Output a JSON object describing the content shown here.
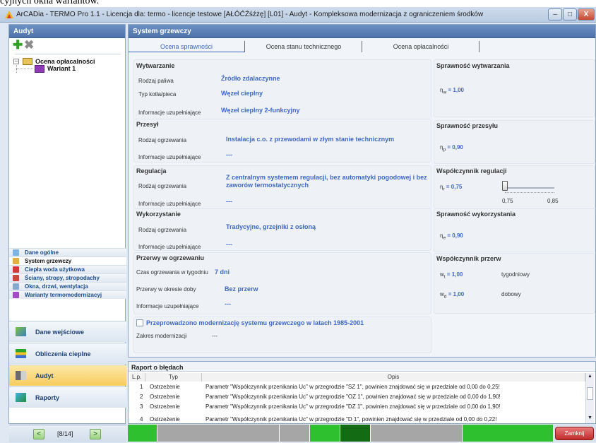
{
  "top_fragment": "cyjnych okna wariantów.",
  "window": {
    "title": "ArCADia - TERMO Pro 1.1 - Licencja dla: termo - licencje testowe [AŁÓĆŹśźżę] [L01] - Audyt - Kompleksowa modernizacja z ograniczeniem środków",
    "min": "–",
    "max": "□",
    "close": "X"
  },
  "left": {
    "header": "Audyt",
    "tree": {
      "root": "Ocena opłacalności",
      "child": "Wariant 1"
    },
    "sections": [
      "Dane ogólne",
      "System grzewczy",
      "Ciepła woda użytkowa",
      "Ściany, stropy, stropodachy",
      "Okna, drzwi, wentylacja",
      "Warianty termomodernizacyj"
    ],
    "nav": [
      "Dane wejściowe",
      "Obliczenia cieplne",
      "Audyt",
      "Raporty"
    ],
    "pager": {
      "prev": "<",
      "label": "[8/14]",
      "next": ">"
    }
  },
  "main": {
    "header": "System grzewczy",
    "tabs": [
      "Ocena sprawności",
      "Ocena stanu technicznego",
      "Ocena opłacalności"
    ],
    "wytwarzanie": {
      "title": "Wytwarzanie",
      "l1": "Rodzaj paliwa",
      "v1": "Źródło zdalaczynne",
      "l2": "Typ kotła/pieca",
      "v2": "Węzeł cieplny",
      "l3": "Informacje uzupełniające",
      "v3": "Węzeł cieplny 2-funkcyjny"
    },
    "przesyl": {
      "title": "Przesył",
      "l1": "Rodzaj ogrzewania",
      "v1": "Instalacja c.o. z przewodami w złym stanie technicznym",
      "l2": "Informacje uzupełniające",
      "v2": "---"
    },
    "regulacja": {
      "title": "Regulacja",
      "l1": "Rodzaj ogrzewania",
      "v1": "Z centralnym systemem regulacji, bez automatyki pogodowej i bez zaworów termostatycznych",
      "l2": "Informacje uzupełniające",
      "v2": "---"
    },
    "wykorzystanie": {
      "title": "Wykorzystanie",
      "l1": "Rodzaj ogrzewania",
      "v1": "Tradycyjne, grzejniki z osłoną",
      "l2": "Informacje uzupełniające",
      "v2": "---"
    },
    "przerwy": {
      "title": "Przerwy w ogrzewaniu",
      "l1": "Czas ogrzewania w tygodniu",
      "v1": "7 dni",
      "l2": "Przerwy w okresie doby",
      "v2": "Bez przerw",
      "l3": "Informacje uzupełniające",
      "v3": "---"
    },
    "modernizacja": {
      "checkbox": "Przeprowadzono modernizację systemu grzewczego w latach 1985-2001",
      "label": "Zakres modernizacji",
      "value": "---"
    },
    "r_wytw": {
      "title": "Sprawność wytwarzania",
      "sym": "η",
      "sub": "w",
      "eq": "= 1,00"
    },
    "r_przes": {
      "title": "Sprawność przesyłu",
      "sym": "η",
      "sub": "p",
      "eq": "= 0,90"
    },
    "r_reg": {
      "title": "Współczynnik regulacji",
      "sym": "η",
      "sub": "r",
      "eq": "= 0,75",
      "tick_min": "0,75",
      "tick_max": "0,85",
      "slider_level": 0.0
    },
    "r_wyk": {
      "title": "Sprawność wykorzystania",
      "sym": "η",
      "sub": "e",
      "eq": "= 0,90"
    },
    "r_przer": {
      "title": "Współczynnik przerw",
      "w1": "w",
      "s1": "t",
      "e1": "= 1,00",
      "n1": "tygodniowy",
      "w2": "w",
      "s2": "d",
      "e2": "= 1,00",
      "n2": "dobowy"
    }
  },
  "report": {
    "title": "Raport o błędach",
    "cols": [
      "L.p.",
      "Typ",
      "Opis"
    ],
    "rows": [
      {
        "n": "1",
        "t": "Ostrzeżenie",
        "d": "Parametr \"Współczynnik przenikania Uc\" w przegrodzie \"SZ 1\", powinien znajdować się w przedziale od 0,00 do 0,25!"
      },
      {
        "n": "2",
        "t": "Ostrzeżenie",
        "d": "Parametr \"Współczynnik przenikania Uc\" w przegrodzie \"OZ 1\", powinien znajdować się w przedziale od 0,00 do 1,90!"
      },
      {
        "n": "3",
        "t": "Ostrzeżenie",
        "d": "Parametr \"Współczynnik przenikania Uc\" w przegrodzie \"DZ 1\", powinien znajdować się w przedziale od 0,00 do 1,90!"
      },
      {
        "n": "4",
        "t": "Ostrzeżenie",
        "d": "Parametr \"Współczynnik przenikania Uc\" w przegrodzie \"D 1\", powinien znajdować się w przedziale od 0,00 do 0,22!"
      }
    ]
  },
  "statusbar": {
    "close": "Zamknij",
    "green": "#2fc02f",
    "dark": "#136b13",
    "gray": "#a6a6a6"
  }
}
